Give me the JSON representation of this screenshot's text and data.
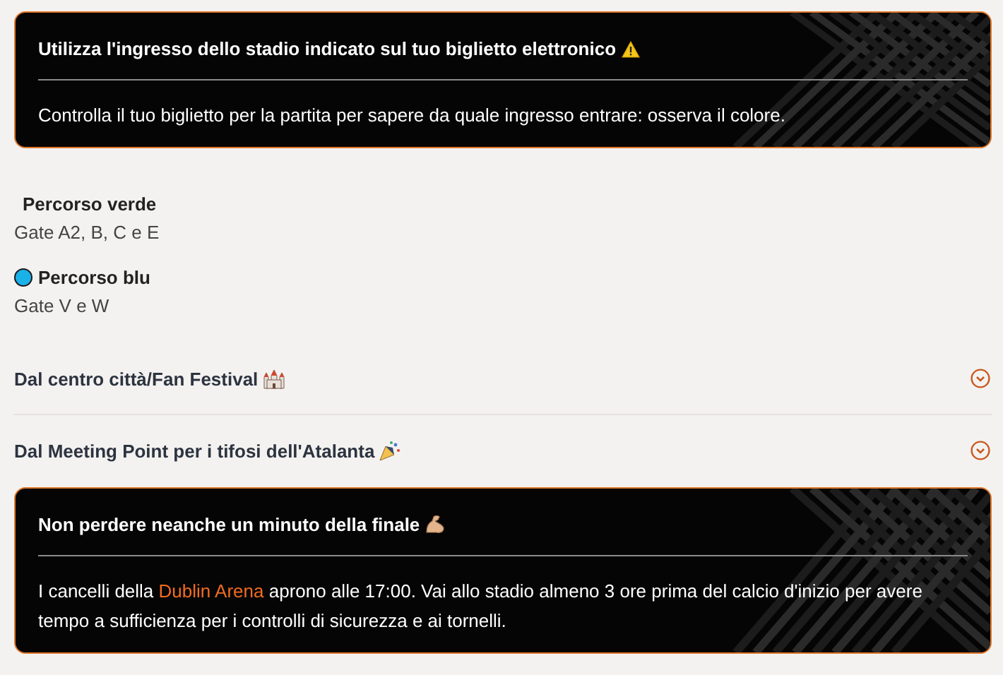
{
  "notice": {
    "title": "Utilizza l'ingresso dello stadio indicato sul tuo biglietto elettronico",
    "text": "Controlla il tuo biglietto per la partita per sapere da quale ingresso entrare: osserva il colore."
  },
  "routes": [
    {
      "name": "Percorso verde",
      "gates": "Gate A2, B, C e E"
    },
    {
      "name": "Percorso blu",
      "gates": "Gate V e W",
      "color": "#1ab0e8"
    }
  ],
  "accordion": [
    {
      "label": "Dal centro città/Fan Festival",
      "expanded": false
    },
    {
      "label": "Dal Meeting Point per i tifosi dell'Atalanta",
      "expanded": false
    }
  ],
  "final_notice": {
    "title": "Non perdere neanche un minuto della finale",
    "text_before": "I cancelli della",
    "link": "Dublin Arena",
    "text_after": "aprono alle 17:00. Vai allo stadio almeno 3 ore prima del calcio d'inizio per avere tempo a sufficienza per i controlli di sicurezza e ai tornelli."
  }
}
